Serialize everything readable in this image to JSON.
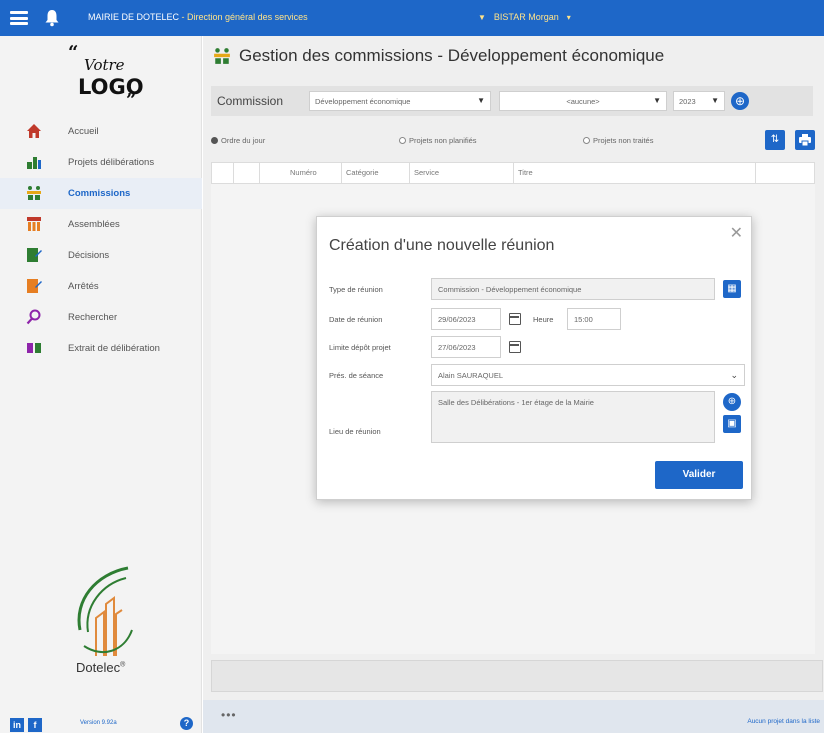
{
  "topbar": {
    "org": "MAIRIE DE DOTELEC",
    "org_sub": "- Direction général des services",
    "user": "BISTAR Morgan"
  },
  "sidebar": {
    "logo_text_top": "Votre",
    "logo_text_bottom": "LOGO",
    "items": [
      {
        "label": "Accueil",
        "icon": "home-icon",
        "active": false
      },
      {
        "label": "Projets délibérations",
        "icon": "projects-icon",
        "active": false
      },
      {
        "label": "Commissions",
        "icon": "commissions-icon",
        "active": true
      },
      {
        "label": "Assemblées",
        "icon": "assemblies-icon",
        "active": false
      },
      {
        "label": "Décisions",
        "icon": "decisions-icon",
        "active": false
      },
      {
        "label": "Arrêtés",
        "icon": "arretes-icon",
        "active": false
      },
      {
        "label": "Rechercher",
        "icon": "search-icon",
        "active": false
      },
      {
        "label": "Extrait de délibération",
        "icon": "extract-icon",
        "active": false
      }
    ],
    "brand": "Dotelec",
    "brand_mark": "®",
    "version": "Version 9.92a",
    "help": "?"
  },
  "main": {
    "title": "Gestion des commissions - Développement économique",
    "filter": {
      "label": "Commission",
      "commission_value": "Développement économique",
      "meeting_value": "<aucune>",
      "year_value": "2023"
    },
    "radios": [
      {
        "label": "Ordre du jour",
        "checked": true
      },
      {
        "label": "Projets non planifiés",
        "checked": false
      },
      {
        "label": "Projets non traités",
        "checked": false
      }
    ],
    "columns": [
      "",
      "",
      "Numéro",
      "Catégorie",
      "Service",
      "Titre"
    ],
    "more": "•••",
    "no_project": "Aucun projet dans la liste"
  },
  "modal": {
    "title": "Création d'une nouvelle réunion",
    "fields": {
      "type_label": "Type de réunion",
      "type_value": "Commission - Développement économique",
      "date_label": "Date de réunion",
      "date_value": "29/06/2023",
      "hour_label": "Heure",
      "hour_value": "15:00",
      "limit_label": "Limite dépôt projet",
      "limit_value": "27/06/2023",
      "pres_label": "Prés. de séance",
      "pres_value": "Alain SAURAQUEL",
      "lieu_label": "Lieu de réunion",
      "lieu_value": "Salle des Délibérations - 1er étage de la Mairie"
    },
    "submit_label": "Valider"
  },
  "colors": {
    "primary": "#1e67c8",
    "topbar_user": "#ffe38a"
  }
}
